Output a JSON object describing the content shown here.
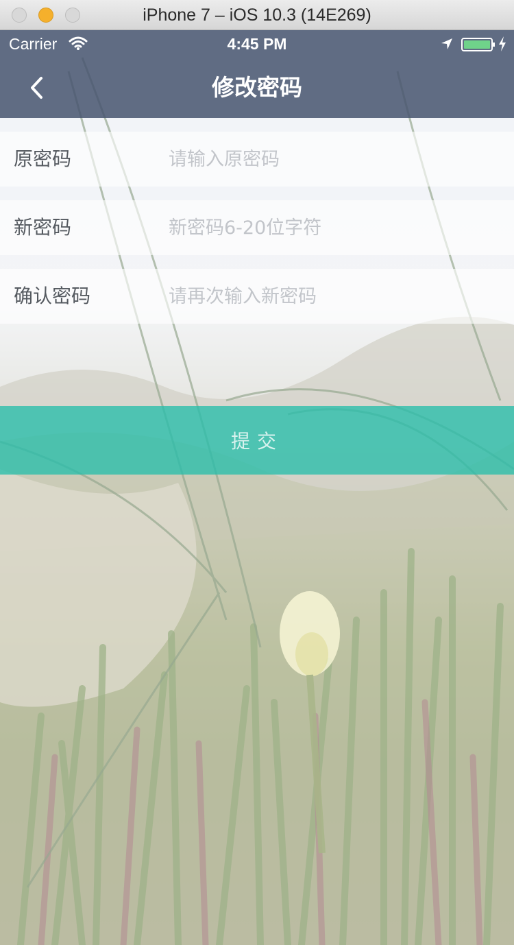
{
  "simulator": {
    "title": "iPhone 7 – iOS 10.3 (14E269)"
  },
  "status_bar": {
    "carrier": "Carrier",
    "time": "4:45 PM",
    "battery_color": "#6fd38a"
  },
  "nav": {
    "title": "修改密码",
    "back_icon": "chevron-left-icon"
  },
  "form": {
    "fields": [
      {
        "label": "原密码",
        "placeholder": "请输入原密码",
        "value": ""
      },
      {
        "label": "新密码",
        "placeholder": "新密码6-20位字符",
        "value": ""
      },
      {
        "label": "确认密码",
        "placeholder": "请再次输入新密码",
        "value": ""
      }
    ]
  },
  "submit": {
    "label": "提交",
    "color": "#28beaa"
  }
}
